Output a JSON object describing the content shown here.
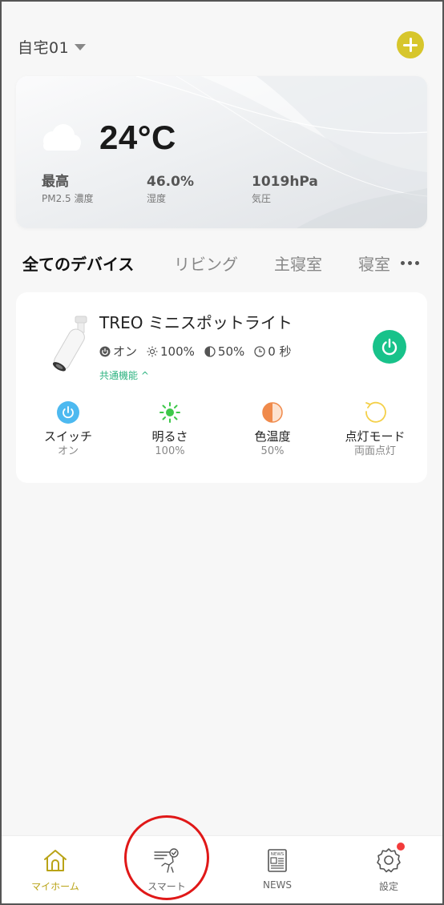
{
  "header": {
    "home_name": "自宅01",
    "add_icon": "plus-icon",
    "accent": "#d7c62c"
  },
  "weather": {
    "icon": "cloud-icon",
    "temperature": "24°C",
    "pm25_value": "最高",
    "pm25_label": "PM2.5 濃度",
    "humidity_value": "46.0%",
    "humidity_label": "湿度",
    "pressure_value": "1019hPa",
    "pressure_label": "気圧"
  },
  "tabs": {
    "items": [
      {
        "label": "全てのデバイス",
        "active": true
      },
      {
        "label": "リビング",
        "active": false
      },
      {
        "label": "主寝室",
        "active": false
      },
      {
        "label": "寝室",
        "active": false
      }
    ],
    "more_icon": "more-dots-icon"
  },
  "device": {
    "name": "TREO ミニスポットライト",
    "status": {
      "power": "オン",
      "brightness": "100%",
      "color_temp": "50%",
      "timer": "0 秒"
    },
    "common_functions_link": "共通機能 ^",
    "power_color": "#18c28a",
    "functions": [
      {
        "icon": "power-icon",
        "label": "スイッチ",
        "value": "オン"
      },
      {
        "icon": "sun-icon",
        "label": "明るさ",
        "value": "100%"
      },
      {
        "icon": "half-circle-icon",
        "label": "色温度",
        "value": "50%"
      },
      {
        "icon": "refresh-icon",
        "label": "点灯モード",
        "value": "両面点灯"
      }
    ]
  },
  "bottom_nav": {
    "items": [
      {
        "icon": "home-icon",
        "label": "マイホーム",
        "active": true
      },
      {
        "icon": "smart-icon",
        "label": "スマート",
        "active": false
      },
      {
        "icon": "news-icon",
        "label": "NEWS",
        "active": false
      },
      {
        "icon": "gear-icon",
        "label": "設定",
        "active": false,
        "badge": true
      }
    ],
    "active_color": "#b9a316"
  },
  "annotation": {
    "highlight_color": "#e01818",
    "highlight_target": "スマート"
  }
}
